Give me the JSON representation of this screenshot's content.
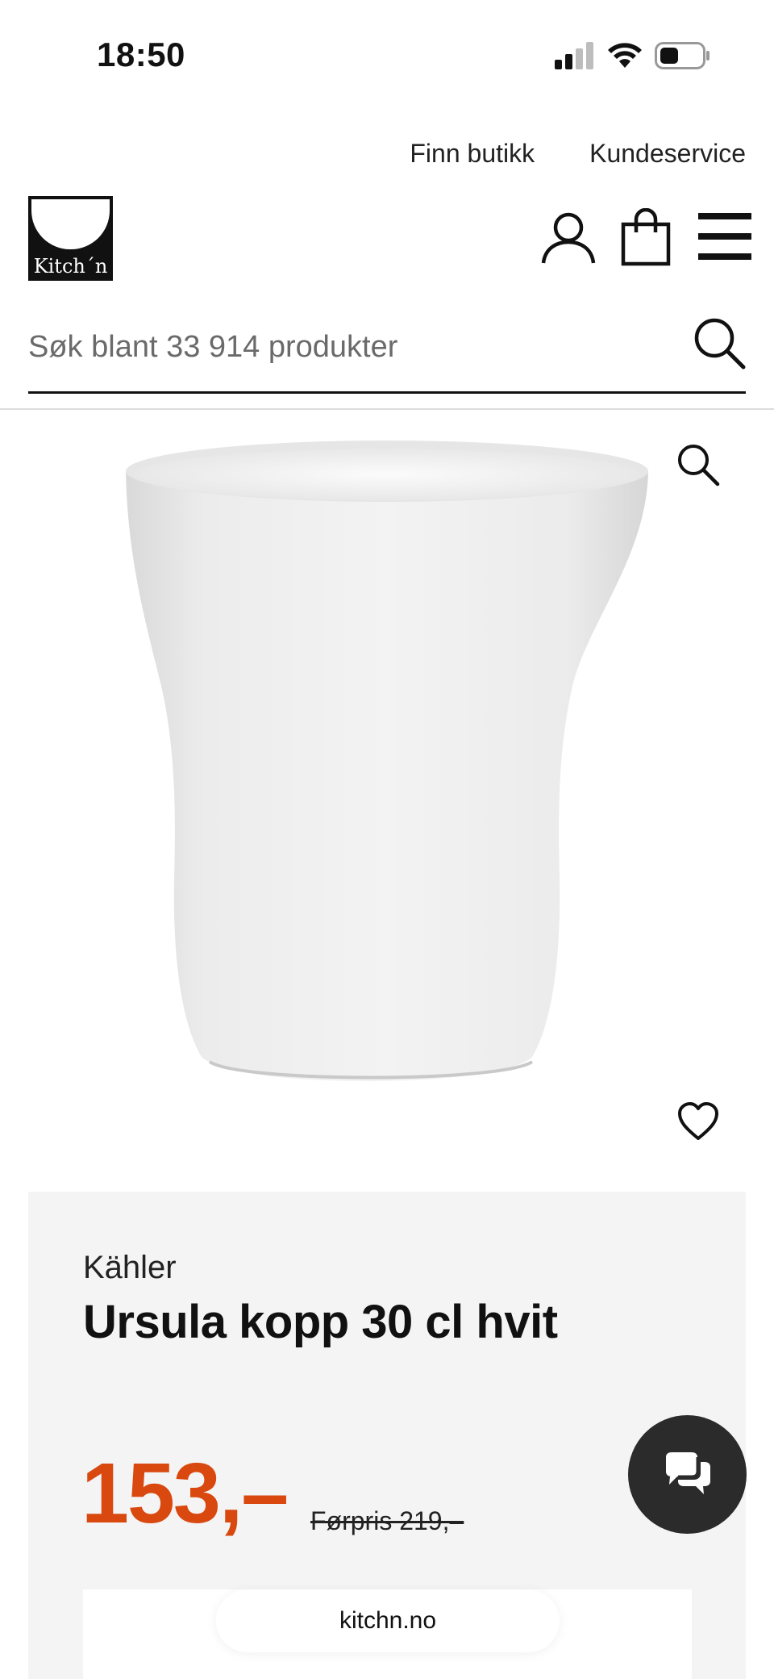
{
  "status": {
    "time": "18:50"
  },
  "header": {
    "links": [
      "Finn butikk",
      "Kundeservice"
    ],
    "logo_text": "Kitch´n"
  },
  "search": {
    "placeholder": "Søk blant 33 914 produkter"
  },
  "product": {
    "brand": "Kähler",
    "title": "Ursula kopp 30 cl hvit",
    "price": "153,–",
    "old_price": "Førpris 219,–"
  },
  "browser": {
    "url": "kitchn.no"
  },
  "colors": {
    "price": "#d9480f",
    "chat_button": "#2b2b2b",
    "panel_bg": "#f4f4f4"
  },
  "icons": [
    "signal-icon",
    "wifi-icon",
    "battery-icon",
    "account-icon",
    "bag-icon",
    "menu-icon",
    "search-icon",
    "zoom-icon",
    "heart-icon",
    "chat-icon"
  ]
}
